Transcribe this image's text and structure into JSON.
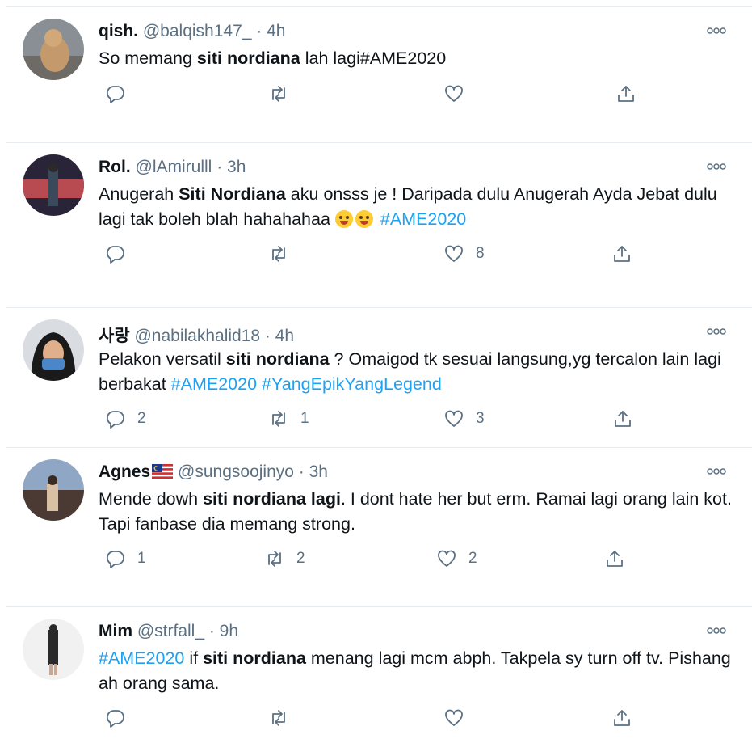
{
  "tweets": [
    {
      "name": "qish.",
      "handle": "@balqish147_",
      "time": "· 4h",
      "text_parts": [
        {
          "t": "So memang "
        },
        {
          "t": "siti nordiana",
          "b": true
        },
        {
          "t": " lah lagi#AME2020"
        }
      ],
      "reply_count": "",
      "retweet_count": "",
      "like_count": ""
    },
    {
      "name": "Rol.",
      "handle": "@lAmirulll",
      "time": "· 3h",
      "text_parts": [
        {
          "t": "Anugerah "
        },
        {
          "t": "Siti Nordiana",
          "b": true
        },
        {
          "t": " aku onsss je ! Daripada dulu Anugerah Ayda Jebat dulu lagi tak boleh blah hahahahaa "
        },
        {
          "emoji": "zany-face"
        },
        {
          "emoji": "winking-tongue-face"
        },
        {
          "t": " "
        },
        {
          "t": "#AME2020",
          "tag": true
        }
      ],
      "reply_count": "",
      "retweet_count": "",
      "like_count": "8"
    },
    {
      "name": "사랑",
      "handle": "@nabilakhalid18",
      "time": "· 4h",
      "text_parts": [
        {
          "t": "Pelakon versatil "
        },
        {
          "t": "siti nordiana",
          "b": true
        },
        {
          "t": " ? Omaigod tk sesuai langsung,yg tercalon lain lagi berbakat "
        },
        {
          "t": "#AME2020",
          "tag": true
        },
        {
          "t": "  "
        },
        {
          "t": "#YangEpikYangLegend",
          "tag": true
        }
      ],
      "reply_count": "2",
      "retweet_count": "1",
      "like_count": "3"
    },
    {
      "name": "Agnes",
      "handle": "@sungsoojinyo",
      "time": "· 3h",
      "flag": "malaysia-flag-icon",
      "text_parts": [
        {
          "t": "Mende dowh "
        },
        {
          "t": "siti nordiana lagi",
          "b": true
        },
        {
          "t": ". I dont hate her but erm. Ramai lagi orang lain kot. Tapi fanbase dia memang strong."
        }
      ],
      "reply_count": "1",
      "retweet_count": "2",
      "like_count": "2"
    },
    {
      "name": "Mim",
      "handle": "@strfall_",
      "time": "· 9h",
      "text_parts": [
        {
          "t": "#AME2020",
          "tag": true
        },
        {
          "t": " if "
        },
        {
          "t": "siti nordiana",
          "b": true
        },
        {
          "t": " menang lagi mcm abph. Takpela sy turn off tv. Pishang ah orang sama."
        }
      ],
      "reply_count": "",
      "retweet_count": "",
      "like_count": ""
    }
  ],
  "icons": {
    "reply": "reply-icon",
    "retweet": "retweet-icon",
    "like": "heart-icon",
    "share": "share-icon",
    "more": "more-options-icon"
  },
  "colors": {
    "name": "#0f1419",
    "meta": "#5b7083",
    "hashtag": "#1da1f2",
    "divider": "#e6ecf0"
  }
}
